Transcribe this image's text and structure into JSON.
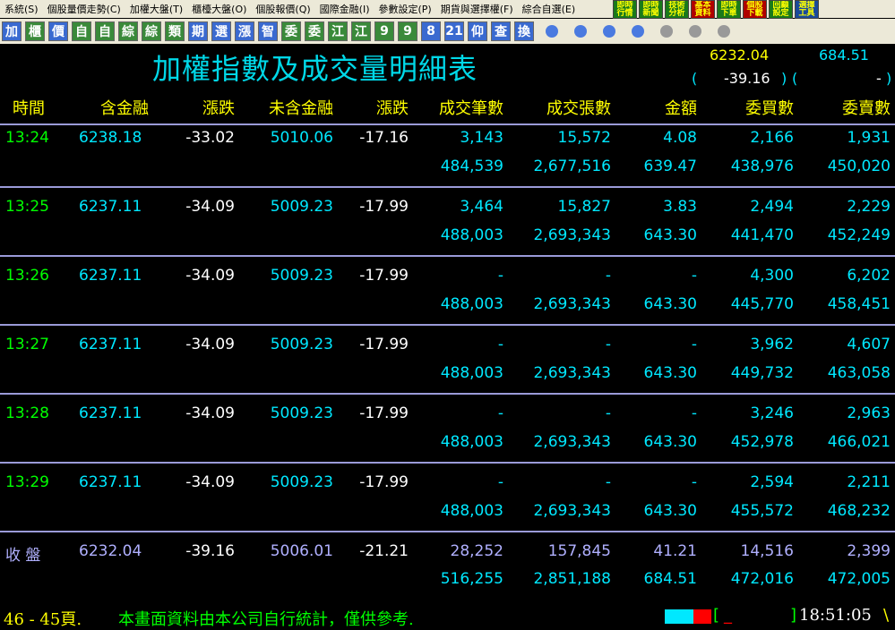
{
  "menu": [
    "系統(S)",
    "個股量價走勢(C)",
    "加權大盤(T)",
    "櫃檯大盤(O)",
    "個股報價(Q)",
    "國際金融(I)",
    "參數設定(P)",
    "期貨與選擇權(F)",
    "綜合自選(E)"
  ],
  "top_icons": [
    "即時行情",
    "即時新聞",
    "技術分析",
    "基本資料",
    "即時下單",
    "個股下載",
    "回顧設定",
    "選擇工具"
  ],
  "toolbar_buttons": [
    "加",
    "櫃",
    "價",
    "自",
    "自",
    "綜",
    "綜",
    "類",
    "期",
    "選",
    "漲",
    "智",
    "委",
    "委",
    "江",
    "江",
    "9",
    "9",
    "8",
    "21",
    "仰",
    "查",
    "換"
  ],
  "title": "加權指數及成交量明細表",
  "index_value": "6232.04",
  "index_change": "-39.16",
  "amount_value": "684.51",
  "amount_change": "-",
  "headers": [
    "時間",
    "含金融",
    "漲跌",
    "未含金融",
    "漲跌",
    "成交筆數",
    "成交張數",
    "金額",
    "委買數",
    "委賣數"
  ],
  "rows": [
    {
      "time": "13:24",
      "idx": "6238.18",
      "chg": "-33.02",
      "ex": "5010.06",
      "exchg": "-17.16",
      "trades": "3,143",
      "vol": "15,572",
      "amt": "4.08",
      "buy": "2,166",
      "sell": "1,931",
      "c_trades": "484,539",
      "c_vol": "2,677,516",
      "c_amt": "639.47",
      "c_buy": "438,976",
      "c_sell": "450,020"
    },
    {
      "time": "13:25",
      "idx": "6237.11",
      "chg": "-34.09",
      "ex": "5009.23",
      "exchg": "-17.99",
      "trades": "3,464",
      "vol": "15,827",
      "amt": "3.83",
      "buy": "2,494",
      "sell": "2,229",
      "c_trades": "488,003",
      "c_vol": "2,693,343",
      "c_amt": "643.30",
      "c_buy": "441,470",
      "c_sell": "452,249"
    },
    {
      "time": "13:26",
      "idx": "6237.11",
      "chg": "-34.09",
      "ex": "5009.23",
      "exchg": "-17.99",
      "trades": "-",
      "vol": "-",
      "amt": "-",
      "buy": "4,300",
      "sell": "6,202",
      "c_trades": "488,003",
      "c_vol": "2,693,343",
      "c_amt": "643.30",
      "c_buy": "445,770",
      "c_sell": "458,451"
    },
    {
      "time": "13:27",
      "idx": "6237.11",
      "chg": "-34.09",
      "ex": "5009.23",
      "exchg": "-17.99",
      "trades": "-",
      "vol": "-",
      "amt": "-",
      "buy": "3,962",
      "sell": "4,607",
      "c_trades": "488,003",
      "c_vol": "2,693,343",
      "c_amt": "643.30",
      "c_buy": "449,732",
      "c_sell": "463,058"
    },
    {
      "time": "13:28",
      "idx": "6237.11",
      "chg": "-34.09",
      "ex": "5009.23",
      "exchg": "-17.99",
      "trades": "-",
      "vol": "-",
      "amt": "-",
      "buy": "3,246",
      "sell": "2,963",
      "c_trades": "488,003",
      "c_vol": "2,693,343",
      "c_amt": "643.30",
      "c_buy": "452,978",
      "c_sell": "466,021"
    },
    {
      "time": "13:29",
      "idx": "6237.11",
      "chg": "-34.09",
      "ex": "5009.23",
      "exchg": "-17.99",
      "trades": "-",
      "vol": "-",
      "amt": "-",
      "buy": "2,594",
      "sell": "2,211",
      "c_trades": "488,003",
      "c_vol": "2,693,343",
      "c_amt": "643.30",
      "c_buy": "455,572",
      "c_sell": "468,232"
    }
  ],
  "close_row": {
    "label": "收 盤",
    "idx": "6232.04",
    "chg": "-39.16",
    "ex": "5006.01",
    "exchg": "-21.21",
    "trades": "28,252",
    "vol": "157,845",
    "amt": "41.21",
    "buy": "14,516",
    "sell": "2,399",
    "c_trades": "516,255",
    "c_vol": "2,851,188",
    "c_amt": "684.51",
    "c_buy": "472,016",
    "c_sell": "472,005"
  },
  "status": {
    "page": "46 - 45頁.",
    "notice": "本畫面資料由本公司自行統計，僅供參考.",
    "input_open": "[",
    "input_cursor": "_",
    "input_close": "]",
    "time": "18:51:05",
    "tail": "\\"
  },
  "colors": {
    "time": "#00ff00",
    "value": "#00e8ff",
    "neg": "#ffffff",
    "header": "#ffff00",
    "close_label": "#b0b0ff"
  }
}
